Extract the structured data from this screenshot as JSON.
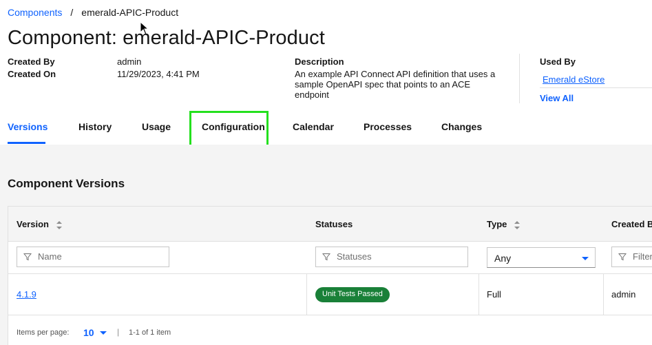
{
  "breadcrumb": {
    "root": "Components",
    "separator": "/",
    "current": "emerald-APIC-Product"
  },
  "page_title": "Component: emerald-APIC-Product",
  "meta": {
    "created_by_label": "Created By",
    "created_by_value": "admin",
    "created_on_label": "Created On",
    "created_on_value": "11/29/2023, 4:41 PM",
    "description_label": "Description",
    "description_text": "An example API Connect API definition that uses a sample OpenAPI spec that points to an ACE endpoint",
    "used_by_label": "Used By",
    "used_by_items": [
      "Emerald eStore"
    ],
    "view_all": "View All"
  },
  "tabs": [
    {
      "label": "Versions",
      "active": true
    },
    {
      "label": "History"
    },
    {
      "label": "Usage"
    },
    {
      "label": "Configuration",
      "highlighted": true
    },
    {
      "label": "Calendar"
    },
    {
      "label": "Processes"
    },
    {
      "label": "Changes"
    }
  ],
  "section_title": "Component Versions",
  "table": {
    "columns": [
      "Version",
      "Statuses",
      "Type",
      "Created B"
    ],
    "filters": {
      "version_placeholder": "Name",
      "statuses_placeholder": "Statuses",
      "type_value": "Any",
      "created_by_placeholder": "Filter"
    },
    "rows": [
      {
        "version": "4.1.9",
        "status": "Unit Tests Passed",
        "type": "Full",
        "created_by": "admin"
      }
    ]
  },
  "pagination": {
    "items_per_page_label": "Items per page:",
    "items_per_page_value": "10",
    "separator": "|",
    "range": "1-1 of 1 item"
  },
  "colors": {
    "accent": "#0f62fe",
    "highlight": "#24e01e",
    "badge": "#198038"
  }
}
